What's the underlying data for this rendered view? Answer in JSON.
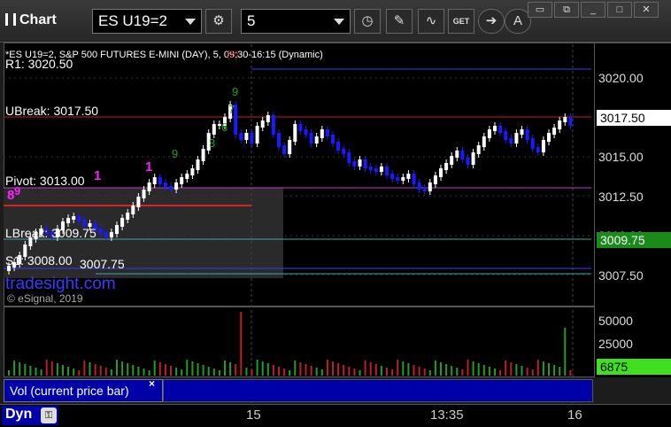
{
  "window": {
    "title": "Chart"
  },
  "toolbar": {
    "symbol": "ES U19=2",
    "interval": "5",
    "get_label": "GET"
  },
  "chart": {
    "header": "*ES U19=2, S&P 500 FUTURES E-MINI (DAY), 5, 09:30-16:15 (Dynamic)",
    "header_marker": "(5)",
    "watermark": "tradesight.com",
    "copyright": "© eSignal, 2019",
    "level_labels": {
      "r1": "R1: 3020.50",
      "ubreak": "UBreak: 3017.50",
      "pivot": "Pivot: 3013.00",
      "lbreak": "LBreak: 3009.75",
      "s1": "S1: 3008.00",
      "s1b": "3007.75"
    },
    "price_axis": [
      "3020.00",
      "3017.50",
      "3015.00",
      "3012.50",
      "3010.00",
      "3007.50"
    ],
    "current_price": "3017.50",
    "lbreak_tag": "3009.75",
    "seq_marks": {
      "a": "9",
      "b": "7",
      "c": "6",
      "d": "3",
      "e": "9",
      "f": "1",
      "g": "8",
      "h": "9",
      "i": "1"
    },
    "colors": {
      "up": "#ffffff",
      "down": "#1a1aff",
      "r1": "#3a3aff",
      "ubreak": "#c02020",
      "pivot": "#c040c0",
      "lbreak": "#3aa8a8",
      "s1": "#3a3aff",
      "volume_up": "#20a020",
      "volume_down": "#c02020"
    }
  },
  "volume": {
    "label": "Vol (current price bar)",
    "close": "×",
    "axis": [
      "50000",
      "25000"
    ],
    "current": "6875"
  },
  "time_axis": {
    "dyn": "Dyn",
    "labels": [
      "15",
      "13:35",
      "16"
    ]
  }
}
